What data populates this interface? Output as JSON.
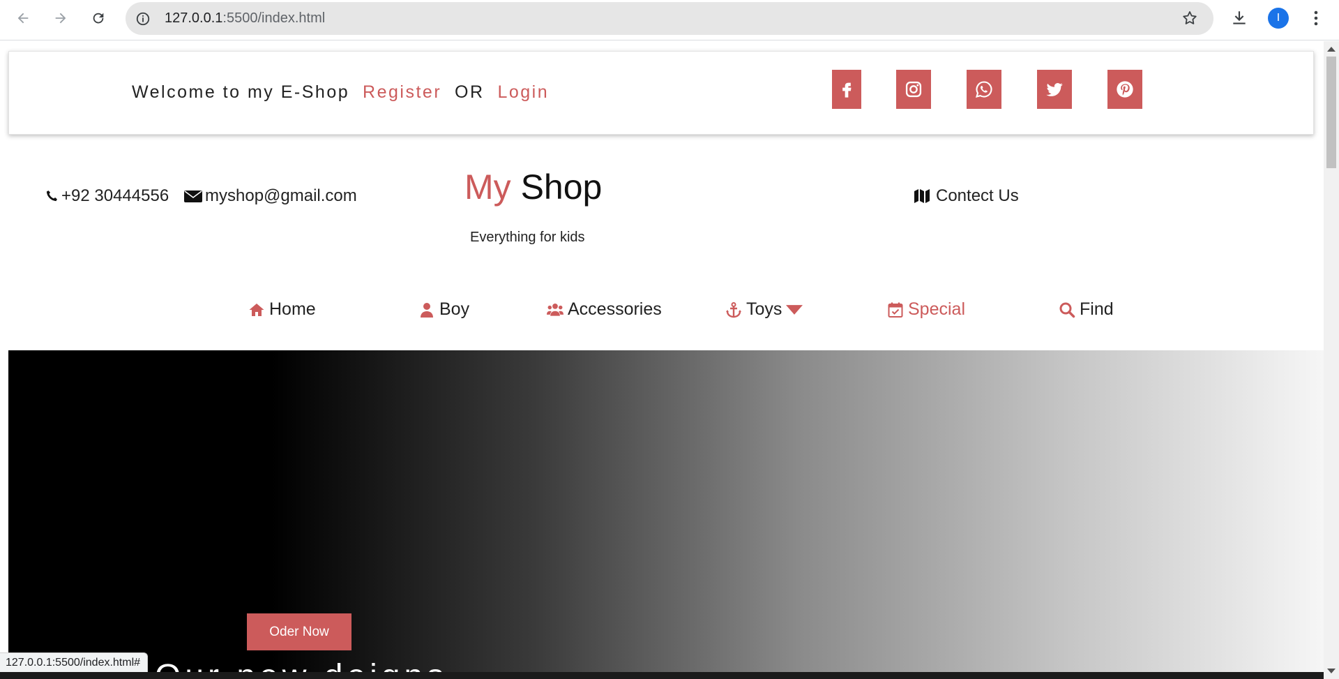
{
  "browser": {
    "url_host": "127.0.0.1",
    "url_rest": ":5500/index.html",
    "profile_initial": "I",
    "status_url": "127.0.0.1:5500/index.html#"
  },
  "topbar": {
    "welcome_text": "Welcome to my E-Shop",
    "register_label": "Register",
    "or_text": "OR",
    "login_label": "Login",
    "social_icons": [
      "facebook-icon",
      "instagram-icon",
      "whatsapp-icon",
      "twitter-icon",
      "pinterest-icon"
    ]
  },
  "header": {
    "phone": "+92 30444556",
    "email": "myshop@gmail.com",
    "brand_first": "My",
    "brand_second": "Shop",
    "tagline": "Everything for kids",
    "contact_label": "Contect Us"
  },
  "nav": {
    "items": [
      {
        "label": "Home",
        "icon": "home-icon"
      },
      {
        "label": "Boy",
        "icon": "user-icon"
      },
      {
        "label": "Accessories",
        "icon": "users-icon"
      },
      {
        "label": "Toys",
        "icon": "anchor-icon"
      },
      {
        "label": "Special",
        "icon": "calendar-check-icon"
      },
      {
        "label": "Find",
        "icon": "search-icon"
      }
    ],
    "active_label": "Special"
  },
  "hero": {
    "button_label": "Oder Now",
    "title": "Our new deigns"
  },
  "colors": {
    "accent": "#cc5b5b",
    "text": "#222222"
  }
}
